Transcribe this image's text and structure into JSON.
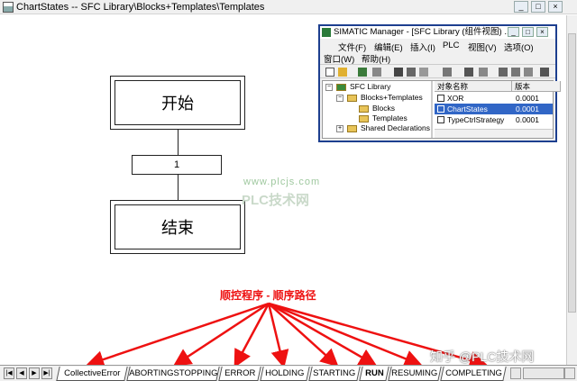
{
  "window": {
    "title": "ChartStates -- SFC Library\\Blocks+Templates\\Templates",
    "buttons": [
      "_",
      "□",
      "×"
    ]
  },
  "sfc": {
    "start_step": "开始",
    "transition": "1",
    "end_step": "结束"
  },
  "watermark": {
    "url": "www.plcjs.com",
    "brand": "PLC技术网"
  },
  "simatic": {
    "title": "SIMATIC Manager - [SFC Library (组件视图) ...",
    "menu_row1": [
      "文件(F)",
      "编辑(E)",
      "插入(I)",
      "PLC",
      "视图(V)",
      "选项(O)"
    ],
    "menu_row2": [
      "窗口(W)",
      "帮助(H)"
    ],
    "tree": {
      "root": "SFC Library",
      "child": "Blocks+Templates",
      "blocks": "Blocks",
      "templates": "Templates",
      "shared": "Shared Declarations"
    },
    "columns": [
      "对象名称",
      "版本"
    ],
    "rows": [
      {
        "name": "XOR",
        "version": "0.0001"
      },
      {
        "name": "ChartStates",
        "version": "0.0001"
      },
      {
        "name": "TypeCtrlStrategy",
        "version": "0.0001"
      }
    ]
  },
  "annotation": "顺控程序 - 顺序路径",
  "tabs": [
    "CollectiveError",
    "ABORTINGSTOPPING",
    "ERROR",
    "HOLDING",
    "STARTING",
    "RUN",
    "RESUMING",
    "COMPLETING"
  ],
  "active_tab": "RUN",
  "footer_watermark": "知乎 @PLC技术网",
  "colors": {
    "annotation": "#ee1111",
    "selection": "#3166c6",
    "inset_border": "#1d3f8f"
  }
}
